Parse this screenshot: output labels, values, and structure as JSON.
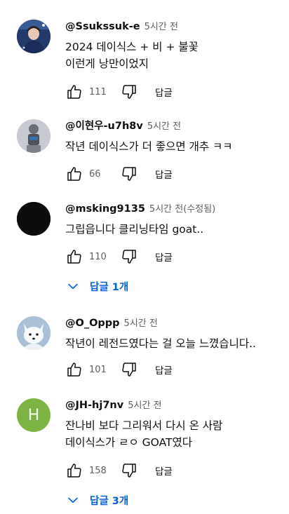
{
  "comments": [
    {
      "author": "@Ssukssuk-e",
      "time": "5시간 전",
      "lines": [
        "2024  데이식스 + 비 + 불꽃",
        "이런게 낭만이었지"
      ],
      "likes": "111",
      "reply_label": "답글",
      "avatar_icon": "photo-avatar-person-blue"
    },
    {
      "author": "@이현우-u7h8v",
      "time": "5시간 전",
      "lines": [
        "작년 데이식스가 더 좋으면 개추 ㅋㅋ"
      ],
      "likes": "66",
      "reply_label": "답글",
      "avatar_icon": "photo-avatar-figure-gray"
    },
    {
      "author": "@msking9135",
      "time": "5시간 전(수정됨)",
      "lines": [
        "그립읍니다 클리닝타임 goat.."
      ],
      "likes": "110",
      "reply_label": "답글",
      "replies": "답글 1개",
      "avatar_icon": "photo-avatar-black"
    },
    {
      "author": "@O_Oppp",
      "time": "5시간 전",
      "lines": [
        "작년이 레전드였다는 걸 오늘 느꼈습니다.."
      ],
      "likes": "101",
      "reply_label": "답글",
      "avatar_icon": "photo-avatar-arctic-fox"
    },
    {
      "author": "@JH-hj7nv",
      "time": "5시간 전",
      "lines": [
        "잔나비 보다 그리워서 다시 온 사람",
        "데이식스가 ㄹㅇ GOAT였다"
      ],
      "likes": "158",
      "reply_label": "답글",
      "replies": "답글 3개",
      "avatar_letter": "H",
      "avatar_color": "#7cb342"
    }
  ],
  "colors": {
    "link": "#065fd4",
    "secondary": "#606060",
    "primary": "#0f0f0f"
  }
}
